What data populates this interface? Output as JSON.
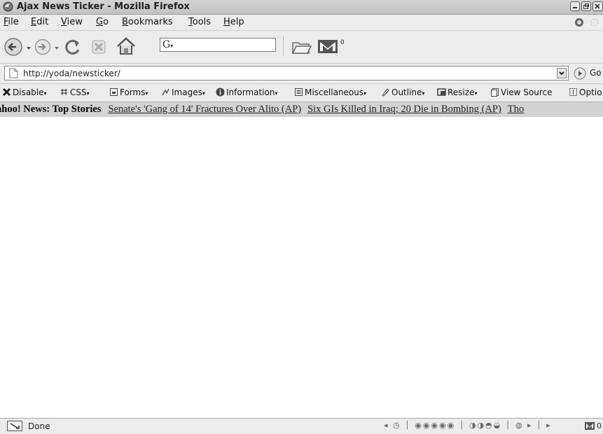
{
  "window": {
    "title": "Ajax News Ticker - Mozilla Firefox"
  },
  "menu": {
    "file": "File",
    "edit": "Edit",
    "view": "View",
    "go": "Go",
    "bookmarks": "Bookmarks",
    "tools": "Tools",
    "help": "Help"
  },
  "navbar": {
    "search_value": "",
    "mail_count": "0"
  },
  "urlbar": {
    "url": "http://yoda/newsticker/",
    "go_label": "Go"
  },
  "devbar": {
    "disable": "Disable",
    "css": "CSS",
    "forms": "Forms",
    "images": "Images",
    "information": "Information",
    "miscellaneous": "Miscellaneous",
    "outline": "Outline",
    "resize": "Resize",
    "view_source": "View Source",
    "options": "Optio"
  },
  "ticker": {
    "source": "ahoo! News: Top Stories",
    "headlines": [
      "Senate's 'Gang of 14' Fractures Over Alito (AP)",
      "Six GIs Killed in Iraq; 20 Die in Bombing (AP)",
      "Tho"
    ]
  },
  "status": {
    "text": "Done",
    "mail_count": "0"
  }
}
